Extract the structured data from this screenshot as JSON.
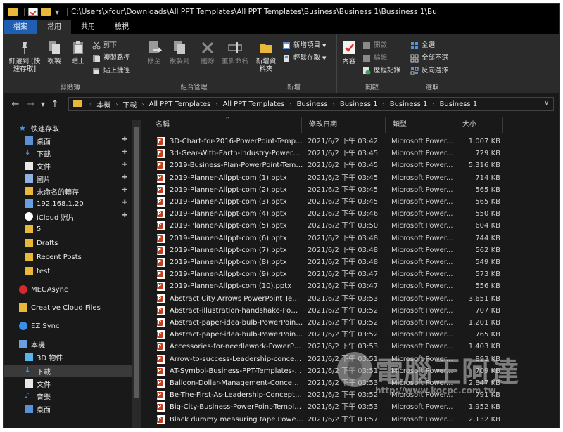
{
  "titlebar": {
    "path": "C:\\Users\\xfour\\Downloads\\All PPT Templates\\All PPT Templates\\Business\\Business 1\\Bussiness 1\\Bu"
  },
  "tabs": [
    {
      "label": "檔案"
    },
    {
      "label": "常用"
    },
    {
      "label": "共用"
    },
    {
      "label": "檢視"
    }
  ],
  "ribbon": {
    "clipboard": {
      "label": "剪貼簿",
      "pin": "釘選到 [快速存取]",
      "copy": "複製",
      "paste": "貼上",
      "cut": "剪下",
      "copy_path": "複製路徑",
      "paste_shortcut": "貼上捷徑"
    },
    "organize": {
      "label": "組合管理",
      "move": "移至",
      "copy_to": "複製到",
      "delete": "刪除",
      "rename": "重新命名"
    },
    "new": {
      "label": "新增",
      "new_folder": "新增資料夾",
      "new_item": "新增項目",
      "easy_access": "輕鬆存取"
    },
    "open": {
      "label": "開啟",
      "properties": "內容",
      "open": "開啟",
      "edit": "編輯",
      "history": "歷程記錄"
    },
    "select": {
      "label": "選取",
      "select_all": "全選",
      "select_none": "全部不選",
      "invert": "反向選擇"
    }
  },
  "breadcrumbs": [
    "本機",
    "下載",
    "All PPT Templates",
    "All PPT Templates",
    "Business",
    "Business 1",
    "Business 1",
    "Business 1"
  ],
  "navpane": {
    "items": [
      {
        "label": "快速存取",
        "icon": "star-icon",
        "indent": 0,
        "pinned": false
      },
      {
        "label": "桌面",
        "icon": "desktop-icon",
        "indent": 1,
        "pinned": true
      },
      {
        "label": "下載",
        "icon": "download-icon",
        "indent": 1,
        "pinned": true
      },
      {
        "label": "文件",
        "icon": "document-icon",
        "indent": 1,
        "pinned": true
      },
      {
        "label": "圖片",
        "icon": "picture-icon",
        "indent": 1,
        "pinned": true
      },
      {
        "label": "未命名的轉存",
        "icon": "folder-icon",
        "indent": 1,
        "pinned": true
      },
      {
        "label": "192.168.1.20",
        "icon": "computer-icon",
        "indent": 1,
        "pinned": true
      },
      {
        "label": "iCloud 照片",
        "icon": "icloud-photos-icon",
        "indent": 1,
        "pinned": true
      },
      {
        "label": "5",
        "icon": "folder-icon",
        "indent": 1,
        "pinned": false
      },
      {
        "label": "Drafts",
        "icon": "folder-icon",
        "indent": 1,
        "pinned": false
      },
      {
        "label": "Recent Posts",
        "icon": "folder-icon",
        "indent": 1,
        "pinned": false
      },
      {
        "label": "test",
        "icon": "folder-icon",
        "indent": 1,
        "pinned": false
      },
      {
        "label": "MEGAsync",
        "icon": "mega-icon",
        "indent": 0,
        "pinned": false
      },
      {
        "label": "Creative Cloud Files",
        "icon": "creative-cloud-folder-icon",
        "indent": 0,
        "pinned": false
      },
      {
        "label": "EZ Sync",
        "icon": "ez-sync-icon",
        "indent": 0,
        "pinned": false
      },
      {
        "label": "本機",
        "icon": "this-pc-icon",
        "indent": 0,
        "pinned": false
      },
      {
        "label": "3D 物件",
        "icon": "3d-objects-icon",
        "indent": 1,
        "pinned": false
      },
      {
        "label": "下載",
        "icon": "download-icon",
        "indent": 1,
        "pinned": false
      },
      {
        "label": "文件",
        "icon": "document-icon",
        "indent": 1,
        "pinned": false
      },
      {
        "label": "音樂",
        "icon": "music-icon",
        "indent": 1,
        "pinned": false
      },
      {
        "label": "桌面",
        "icon": "desktop-icon",
        "indent": 1,
        "pinned": false
      }
    ]
  },
  "columns": {
    "name": "名稱",
    "date": "修改日期",
    "type": "類型",
    "size": "大小"
  },
  "files": [
    {
      "name": "3D-Chart-for-2016-PowerPoint-Templ...",
      "date": "2021/6/2 下午 03:42",
      "type": "Microsoft Power...",
      "size": "1,007 KB"
    },
    {
      "name": "3d-Gear-With-Earth-Industry-PowerPo...",
      "date": "2021/6/2 下午 03:45",
      "type": "Microsoft Power...",
      "size": "729 KB"
    },
    {
      "name": "2019-Business-Plan-PowerPoint-Temp...",
      "date": "2021/6/2 下午 03:45",
      "type": "Microsoft Power...",
      "size": "5,316 KB"
    },
    {
      "name": "2019-Planner-Allppt-com (1).pptx",
      "date": "2021/6/2 下午 03:45",
      "type": "Microsoft Power...",
      "size": "714 KB"
    },
    {
      "name": "2019-Planner-Allppt-com (2).pptx",
      "date": "2021/6/2 下午 03:45",
      "type": "Microsoft Power...",
      "size": "565 KB"
    },
    {
      "name": "2019-Planner-Allppt-com (3).pptx",
      "date": "2021/6/2 下午 03:45",
      "type": "Microsoft Power...",
      "size": "565 KB"
    },
    {
      "name": "2019-Planner-Allppt-com (4).pptx",
      "date": "2021/6/2 下午 03:46",
      "type": "Microsoft Power...",
      "size": "550 KB"
    },
    {
      "name": "2019-Planner-Allppt-com (5).pptx",
      "date": "2021/6/2 下午 03:50",
      "type": "Microsoft Power...",
      "size": "604 KB"
    },
    {
      "name": "2019-Planner-Allppt-com (6).pptx",
      "date": "2021/6/2 下午 03:48",
      "type": "Microsoft Power...",
      "size": "744 KB"
    },
    {
      "name": "2019-Planner-Allppt-com (7).pptx",
      "date": "2021/6/2 下午 03:48",
      "type": "Microsoft Power...",
      "size": "562 KB"
    },
    {
      "name": "2019-Planner-Allppt-com (8).pptx",
      "date": "2021/6/2 下午 03:48",
      "type": "Microsoft Power...",
      "size": "549 KB"
    },
    {
      "name": "2019-Planner-Allppt-com (9).pptx",
      "date": "2021/6/2 下午 03:47",
      "type": "Microsoft Power...",
      "size": "573 KB"
    },
    {
      "name": "2019-Planner-Allppt-com (10).pptx",
      "date": "2021/6/2 下午 03:47",
      "type": "Microsoft Power...",
      "size": "556 KB"
    },
    {
      "name": "Abstract City Arrows PowerPoint Templ...",
      "date": "2021/6/2 下午 03:53",
      "type": "Microsoft Power...",
      "size": "3,651 KB"
    },
    {
      "name": "Abstract-illustration-handshake-Power...",
      "date": "2021/6/2 下午 03:52",
      "type": "Microsoft Power...",
      "size": "707 KB"
    },
    {
      "name": "Abstract-paper-idea-bulb-PowerPoint...",
      "date": "2021/6/2 下午 03:52",
      "type": "Microsoft Power...",
      "size": "1,201 KB"
    },
    {
      "name": "Abstract-paper-idea-bulb-PowerPoint...",
      "date": "2021/6/2 下午 03:52",
      "type": "Microsoft Power...",
      "size": "765 KB"
    },
    {
      "name": "Accessories-for-needlework-PowerPoi...",
      "date": "2021/6/2 下午 03:53",
      "type": "Microsoft Power...",
      "size": "1,403 KB"
    },
    {
      "name": "Arrow-to-success-Leadership-concept...",
      "date": "2021/6/2 下午 03:51",
      "type": "Microsoft Power...",
      "size": "893 KB"
    },
    {
      "name": "AT-Symbol-Business-PPT-Templates-S...",
      "date": "2021/6/2 下午 03:51",
      "type": "Microsoft Power...",
      "size": "709 KB"
    },
    {
      "name": "Balloon-Dollar-Management-Concept...",
      "date": "2021/6/2 下午 03:53",
      "type": "Microsoft Power...",
      "size": "2,847 KB"
    },
    {
      "name": "Be-The-First-As-Leadership-Concept-B...",
      "date": "2021/6/2 下午 03:52",
      "type": "Microsoft Power...",
      "size": "791 KB"
    },
    {
      "name": "Big-City-Business-PowerPoint-Templat...",
      "date": "2021/6/2 下午 03:53",
      "type": "Microsoft Power...",
      "size": "1,952 KB"
    },
    {
      "name": "Black dummy measuring tape PowerP...",
      "date": "2021/6/2 下午 03:57",
      "type": "Microsoft Power...",
      "size": "2,132 KB"
    }
  ],
  "watermark": {
    "title": "電腦王阿達",
    "url": "http://www.kocpc.com.tw"
  },
  "colors": {
    "file_tab": "#1f5fb3",
    "folder": "#e8b83a",
    "pptx": "#c43e1c",
    "background": "#191919"
  }
}
